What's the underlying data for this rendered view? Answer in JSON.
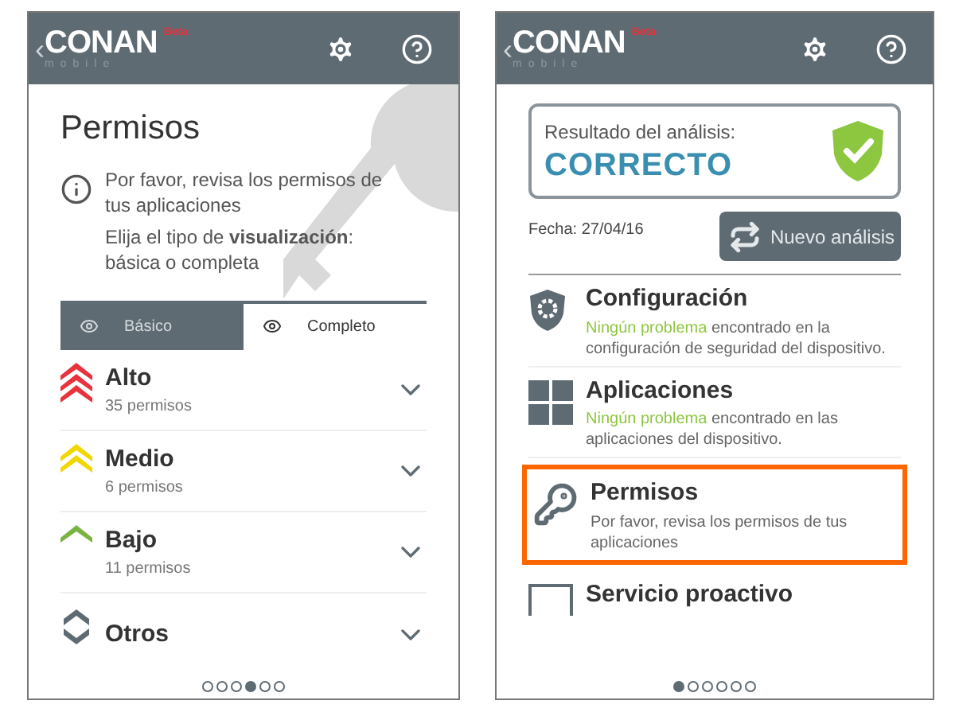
{
  "left_screen": {
    "header": {
      "back": "‹",
      "logo": "CONAN",
      "logo_sub": "mobile",
      "badge": "Beta"
    },
    "title": "Permisos",
    "info": "Por favor, revisa los permisos de tus aplicaciones",
    "hint": "Elija el tipo de **visualización**: básica o completa",
    "tabs": [
      {
        "label": "Básico",
        "selected": false
      },
      {
        "label": "Completo",
        "selected": true
      }
    ],
    "levels": [
      {
        "kind": "high",
        "name": "Alto",
        "count": "35 permisos",
        "color": "#e8323c"
      },
      {
        "kind": "medium",
        "name": "Medio",
        "count": "6 permisos",
        "color": "#f2d600"
      },
      {
        "kind": "low",
        "name": "Bajo",
        "count": "11 permisos",
        "color": "#7cb342"
      },
      {
        "kind": "other",
        "name": "Otros",
        "color": "#5f6b73"
      }
    ],
    "page_dots": [
      {
        "selected": false
      },
      {
        "selected": false
      },
      {
        "selected": false
      },
      {
        "selected": true
      },
      {
        "selected": false
      },
      {
        "selected": false
      }
    ]
  },
  "right_screen": {
    "header": {
      "back": "‹",
      "logo": "CONAN",
      "logo_sub": "mobile",
      "badge": "Beta"
    },
    "result_label": "Resultado del análisis:",
    "result": "CORRECTO",
    "date": "Fecha: 27/04/16",
    "new_scan_button": "Nuevo análisis",
    "sections": [
      {
        "kind": "settings",
        "title": "Configuración",
        "highlight": "Ningún problema",
        "text": " encontrado en la configuración de seguridad del dispositivo.",
        "highlighted": false
      },
      {
        "kind": "apps",
        "title": "Aplicaciones",
        "highlight": "Ningún problema",
        "text": " encontrado en las aplicaciones del dispositivo.",
        "highlighted": false
      },
      {
        "kind": "permissions",
        "title": "Permisos",
        "text": "Por favor, revisa los permisos de tus aplicaciones",
        "highlighted": true
      },
      {
        "kind": "proactive",
        "title": "Servicio proactivo",
        "highlighted": false
      }
    ],
    "page_dots": [
      {
        "selected": true
      },
      {
        "selected": false
      },
      {
        "selected": false
      },
      {
        "selected": false
      },
      {
        "selected": false
      },
      {
        "selected": false
      }
    ]
  }
}
